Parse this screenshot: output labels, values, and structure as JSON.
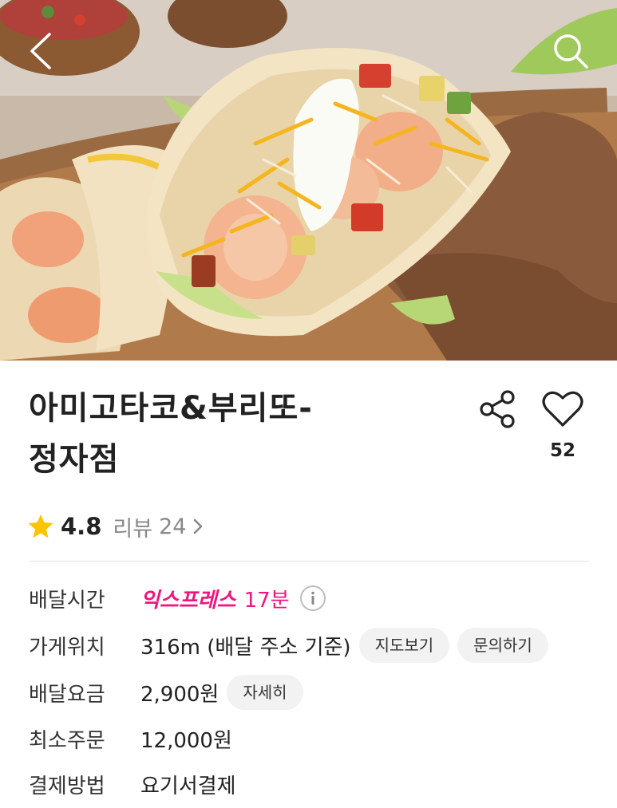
{
  "store": {
    "name": "아미고타코&부리또-\n정자점",
    "like_count": "52",
    "rating": "4.8",
    "review_label": "리뷰",
    "review_count": "24"
  },
  "info": {
    "delivery_time": {
      "label": "배달시간",
      "express": "익스프레스",
      "minutes": "17분"
    },
    "location": {
      "label": "가게위치",
      "value": "316m (배달 주소 기준)",
      "map_button": "지도보기",
      "inquiry_button": "문의하기"
    },
    "delivery_fee": {
      "label": "배달요금",
      "value": "2,900원",
      "detail_button": "자세히"
    },
    "min_order": {
      "label": "최소주문",
      "value": "12,000원"
    },
    "payment": {
      "label": "결제방법",
      "value": "요기서결제"
    }
  },
  "colors": {
    "accent": "#f0157e",
    "star": "#ffc400",
    "chip_bg": "#f2f2f2"
  },
  "icons": [
    "back-arrow-icon",
    "search-icon",
    "share-icon",
    "heart-icon",
    "star-icon",
    "chevron-right-icon",
    "info-icon"
  ]
}
